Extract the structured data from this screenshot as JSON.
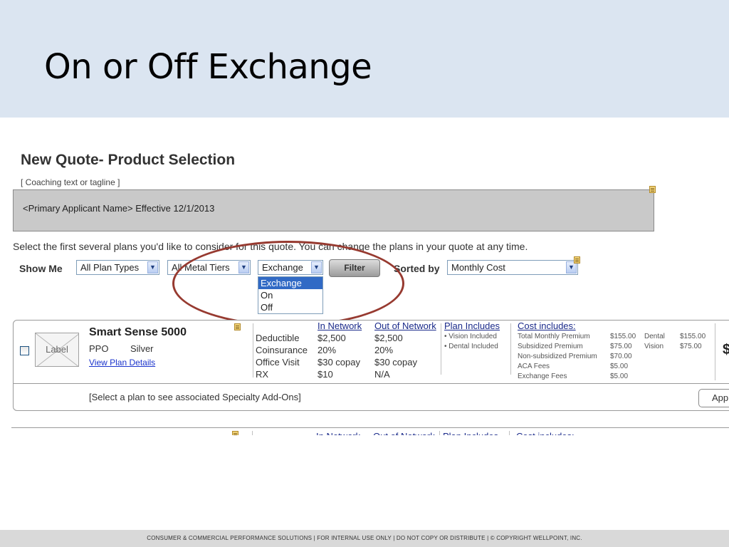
{
  "slide": {
    "title": "On or Off Exchange",
    "footer": "CONSUMER & COMMERCIAL PERFORMANCE SOLUTIONS   |   FOR INTERNAL USE ONLY   |  DO NOT COPY OR DISTRIBUTE   | © COPYRIGHT  WELLPOINT, INC."
  },
  "quote": {
    "heading": "New Quote- Product Selection",
    "coaching_text": "[ Coaching text or tagline ]",
    "applicant_line": "<Primary Applicant Name>  Effective 12/1/2013",
    "instructions": "Select the first several plans you'd like to consider for this quote. You can change the plans in your quote at any time."
  },
  "filters": {
    "show_me_label": "Show Me",
    "plan_types_value": "All Plan Types",
    "metal_tiers_value": "All Metal Tiers",
    "exchange_value": "Exchange",
    "exchange_options": [
      "Exchange",
      "On",
      "Off"
    ],
    "filter_button": "Filter",
    "sorted_by_label": "Sorted by",
    "sort_value": "Monthly Cost"
  },
  "plan": {
    "image_label": "Label",
    "name": "Smart Sense 5000",
    "type": "PPO",
    "tier": "Silver",
    "details_link": "View Plan Details",
    "in_network_header": "In Network",
    "out_network_header": "Out of Network",
    "benefits": [
      {
        "label": "Deductible",
        "in": "$2,500",
        "out": "$2,500"
      },
      {
        "label": "Coinsurance",
        "in": "20%",
        "out": "20%"
      },
      {
        "label": "Office Visit",
        "in": "$30 copay",
        "out": "$30 copay"
      },
      {
        "label": "RX",
        "in": "$10",
        "out": "N/A"
      }
    ],
    "plan_includes_header": "Plan Includes",
    "plan_includes": [
      "• Vision Included",
      "• Dental Included"
    ],
    "cost_includes_header": "Cost includes:",
    "costs": [
      {
        "label": "Total Monthly Premium",
        "value": "$155.00"
      },
      {
        "label": "Subsidized Premium",
        "value": "$75.00"
      },
      {
        "label": "Non-subsidized Premium",
        "value": "$70.00"
      },
      {
        "label": "ACA Fees",
        "value": "$5.00"
      },
      {
        "label": "Exchange Fees",
        "value": "$5.00"
      }
    ],
    "addon_costs": [
      {
        "label": "Dental",
        "value": "$155.00"
      },
      {
        "label": "Vision",
        "value": "$75.00"
      }
    ],
    "price_cut": "$",
    "addons_text": "[Select a plan to see associated Specialty Add-Ons]",
    "add_button": "App"
  },
  "plan2_headers": {
    "in_network": "In Network",
    "out_network": "Out of Network",
    "plan_includes": "Plan Includes",
    "cost_includes": "Cost includes:"
  }
}
